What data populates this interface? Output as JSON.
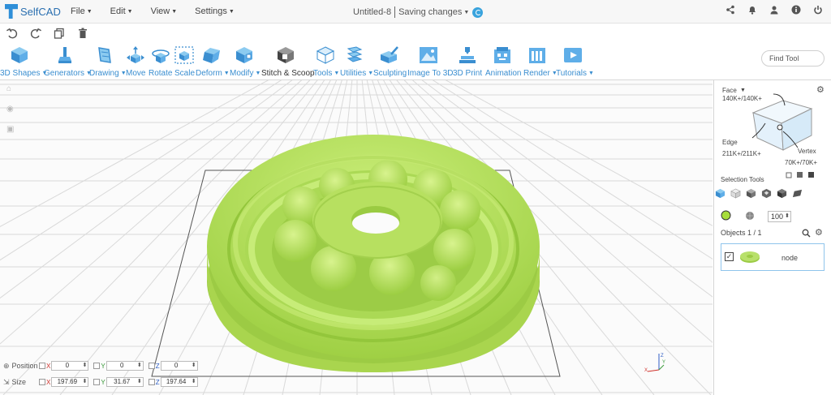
{
  "app": {
    "name": "SelfCAD"
  },
  "menu": [
    {
      "label": "File"
    },
    {
      "label": "Edit"
    },
    {
      "label": "View"
    },
    {
      "label": "Settings"
    }
  ],
  "document": {
    "title": "Untitled-8",
    "status": "Saving changes"
  },
  "top_icons": [
    "share-icon",
    "bell-icon",
    "user-icon",
    "info-icon",
    "power-icon"
  ],
  "actions": [
    "undo-icon",
    "redo-icon",
    "copy-icon",
    "delete-icon"
  ],
  "toolbar": {
    "tools": [
      {
        "label": "3D Shapes",
        "dropdown": true,
        "icon": "cube-icon"
      },
      {
        "label": "Generators",
        "dropdown": true,
        "icon": "generator-icon"
      },
      {
        "label": "Drawing",
        "dropdown": true,
        "icon": "drawing-icon"
      },
      {
        "label": "Move",
        "dropdown": false,
        "icon": "move-icon"
      },
      {
        "label": "Rotate",
        "dropdown": false,
        "icon": "rotate-icon"
      },
      {
        "label": "Scale",
        "dropdown": false,
        "icon": "scale-icon"
      },
      {
        "label": "Deform",
        "dropdown": true,
        "icon": "deform-icon"
      },
      {
        "label": "Modify",
        "dropdown": true,
        "icon": "modify-icon"
      },
      {
        "label": "Stitch & Scoop",
        "dropdown": false,
        "icon": "stitch-scoop-icon"
      },
      {
        "label": "Tools",
        "dropdown": true,
        "icon": "tools-icon"
      },
      {
        "label": "Utilities",
        "dropdown": true,
        "icon": "utilities-icon"
      },
      {
        "label": "Sculpting",
        "dropdown": false,
        "icon": "sculpting-icon"
      },
      {
        "label": "Image To 3D",
        "dropdown": false,
        "icon": "image-to-3d-icon"
      },
      {
        "label": "3D Print",
        "dropdown": false,
        "icon": "3d-print-icon"
      },
      {
        "label": "Animation",
        "dropdown": false,
        "icon": "animation-icon"
      },
      {
        "label": "Render",
        "dropdown": true,
        "icon": "render-icon"
      },
      {
        "label": "Tutorials",
        "dropdown": true,
        "icon": "tutorials-icon"
      }
    ],
    "find_tool_placeholder": "Find Tool"
  },
  "transform": {
    "position": {
      "label": "Position",
      "x": "0",
      "y": "0",
      "z": "0"
    },
    "size": {
      "label": "Size",
      "x": "197.69",
      "y": "31.67",
      "z": "197.64"
    }
  },
  "panel": {
    "face_label": "Face",
    "face_count": "140K+/140K+",
    "edge_label": "Edge",
    "edge_count": "211K+/211K+",
    "vertex_label": "Vertex",
    "vertex_count": "70K+/70K+",
    "selection_tools_label": "Selection Tools",
    "selection_value": "100",
    "objects_label": "Objects 1 / 1",
    "object_name": "node"
  },
  "colors": {
    "accent": "#3a8ed0",
    "model": "#b2e05a",
    "selection": "#a7dd3b"
  }
}
